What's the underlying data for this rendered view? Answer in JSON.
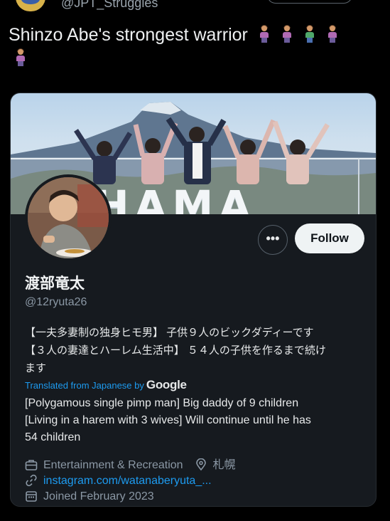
{
  "top": {
    "handle": "@JPT_Struggles"
  },
  "tweet": {
    "text": "Shinzo Abe's strongest warrior",
    "emojis": [
      "woman-purple-icon",
      "woman-purple-icon",
      "man-green-icon",
      "woman-purple-icon",
      "woman-purple-icon"
    ]
  },
  "profile": {
    "display_name": "渡部竜太",
    "handle": "@12ryuta26",
    "more_label": "•••",
    "follow_label": "Follow",
    "bio_jp_line1": "【一夫多妻制の独身ヒモ男】 子供９人のビックダディーです",
    "bio_jp_line2": "【３人の妻達とハーレム生活中】 ５４人の子供を作るまで続け",
    "bio_jp_line3": "ます",
    "translated_label": "Translated from Japanese by",
    "translated_brand": "Google",
    "bio_en_line1": "[Polygamous single pimp man] Big daddy of 9 children",
    "bio_en_line2": "[Living in a harem with 3 wives] Will continue until he has",
    "bio_en_line3": "54 children",
    "category": "Entertainment & Recreation",
    "location": "札幌",
    "link": "instagram.com/watanaberyuta_...",
    "joined": "Joined February 2023",
    "banner_letters": "HAMA"
  },
  "colors": {
    "accent": "#1d9bf0",
    "card_bg": "#161a1f",
    "muted": "#8b98a5"
  }
}
